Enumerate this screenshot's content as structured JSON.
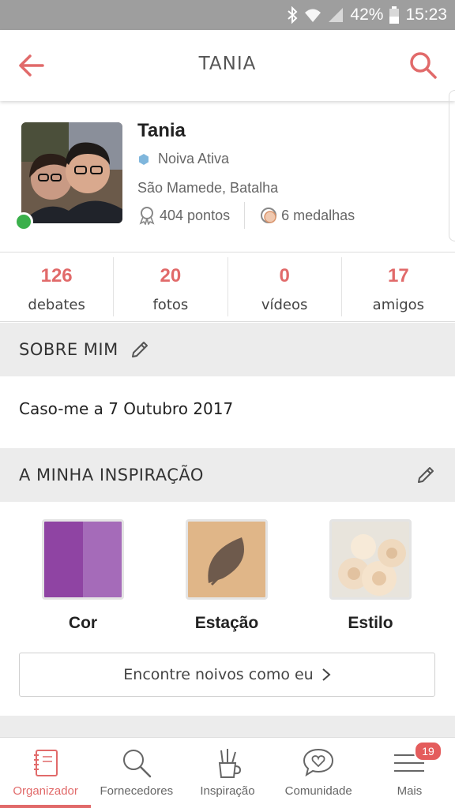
{
  "status_bar": {
    "battery": "42%",
    "time": "15:23"
  },
  "app_bar": {
    "title": "TANIA"
  },
  "profile": {
    "name": "Tania",
    "role": "Noiva Ativa",
    "location": "São Mamede, Batalha",
    "points": "404 pontos",
    "medals": "6 medalhas"
  },
  "counters": [
    {
      "value": "126",
      "label": "debates"
    },
    {
      "value": "20",
      "label": "fotos"
    },
    {
      "value": "0",
      "label": "vídeos"
    },
    {
      "value": "17",
      "label": "amigos"
    }
  ],
  "about": {
    "header": "SOBRE MIM",
    "text": "Caso-me a 7 Outubro 2017"
  },
  "inspiration": {
    "header": "A MINHA INSPIRAÇÃO",
    "items": [
      {
        "label": "Cor"
      },
      {
        "label": "Estação"
      },
      {
        "label": "Estilo"
      }
    ],
    "find_button": "Encontre noivos como eu"
  },
  "bottom_nav": {
    "items": [
      {
        "label": "Organizador"
      },
      {
        "label": "Fornecedores"
      },
      {
        "label": "Inspiração"
      },
      {
        "label": "Comunidade"
      },
      {
        "label": "Mais"
      }
    ],
    "badge": "19"
  },
  "colors": {
    "accent": "#e16a6a",
    "online": "#3ab04b",
    "section_bg": "#ececec"
  }
}
